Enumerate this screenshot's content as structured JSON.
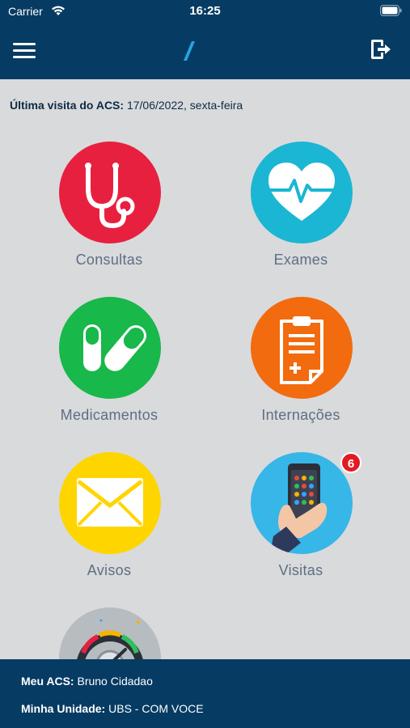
{
  "status_bar": {
    "carrier": "Carrier",
    "time": "16:25"
  },
  "header": {
    "menu_icon": "hamburger-menu-icon",
    "logo": "app-logo-slash",
    "logout_icon": "logout-icon"
  },
  "last_visit": {
    "label": "Última visita do ACS:",
    "value": "17/06/2022, sexta-feira"
  },
  "tiles": [
    {
      "label": "Consultas",
      "icon": "stethoscope-icon",
      "color": "#e8203f"
    },
    {
      "label": "Exames",
      "icon": "heart-pulse-icon",
      "color": "#1bb6d3"
    },
    {
      "label": "Medicamentos",
      "icon": "pills-icon",
      "color": "#18b84a"
    },
    {
      "label": "Internações",
      "icon": "clipboard-icon",
      "color": "#f26b0f"
    },
    {
      "label": "Avisos",
      "icon": "envelope-icon",
      "color": "#ffd500"
    },
    {
      "label": "Visitas",
      "icon": "phone-in-hand-icon",
      "color": "#37b6e8",
      "badge": "6"
    },
    {
      "label": "",
      "icon": "gauge-icon",
      "color": "#b7bcc1"
    }
  ],
  "footer": {
    "acs_label": "Meu ACS:",
    "acs_value": "Bruno Cidadao",
    "unit_label": "Minha Unidade:",
    "unit_value": "UBS - COM VOCE"
  },
  "colors": {
    "primary": "#063b63",
    "background": "#d9dadc",
    "badge": "#e21b23"
  }
}
